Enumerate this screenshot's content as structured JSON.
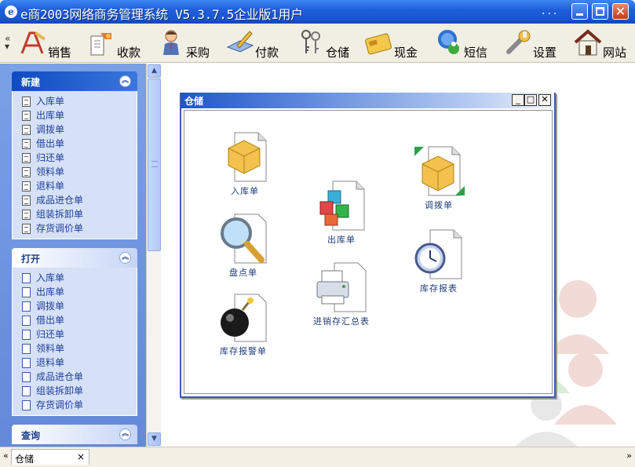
{
  "app": {
    "title": "e商2003网络商务管理系统 V5.3.7.5企业版1用户",
    "title_dots": "...",
    "icon_letter": "e"
  },
  "toolbar": {
    "chevron": "«",
    "items": [
      {
        "label": "销售",
        "icon": "sales-icon"
      },
      {
        "label": "收款",
        "icon": "receipt-icon"
      },
      {
        "label": "采购",
        "icon": "purchase-icon"
      },
      {
        "label": "付款",
        "icon": "payment-icon"
      },
      {
        "label": "仓储",
        "icon": "warehouse-keys-icon"
      },
      {
        "label": "现金",
        "icon": "cash-card-icon"
      },
      {
        "label": "短信",
        "icon": "sms-icon"
      },
      {
        "label": "设置",
        "icon": "wrench-icon"
      },
      {
        "label": "网站",
        "icon": "house-icon"
      }
    ]
  },
  "sidebar": {
    "groups": [
      {
        "title": "新建",
        "items": [
          "入库单",
          "出库单",
          "调拨单",
          "借出单",
          "归还单",
          "领料单",
          "退料单",
          "成品进仓单",
          "组装拆卸单",
          "存货调价单"
        ]
      },
      {
        "title": "打开",
        "items": [
          "入库单",
          "出库单",
          "调拨单",
          "借出单",
          "归还单",
          "领料单",
          "退料单",
          "成品进仓单",
          "组装拆卸单",
          "存货调价单"
        ]
      },
      {
        "title": "查询",
        "items": []
      }
    ],
    "collapse_glyph": "︽"
  },
  "inner_window": {
    "title": "仓储",
    "items": [
      {
        "label": "入库单",
        "icon": "inbound-box-icon"
      },
      {
        "label": "出库单",
        "icon": "outbound-cubes-icon"
      },
      {
        "label": "调拨单",
        "icon": "transfer-box-icon"
      },
      {
        "label": "盘点单",
        "icon": "magnifier-icon"
      },
      {
        "label": "库存报表",
        "icon": "clock-report-icon"
      },
      {
        "label": "进销存汇总表",
        "icon": "printer-icon"
      },
      {
        "label": "库存报警单",
        "icon": "bomb-icon"
      }
    ]
  },
  "tabs": {
    "left_chevron": "«",
    "right_chevron": "»",
    "items": [
      {
        "label": "仓储",
        "close": "×"
      }
    ]
  },
  "colors": {
    "title_blue": "#1a55d0",
    "sidebar_blue": "#6389d8",
    "group_header_dark": "#0d4bc0",
    "group_body": "#d6e1f7",
    "toolbar_bg": "#f1efe3"
  }
}
